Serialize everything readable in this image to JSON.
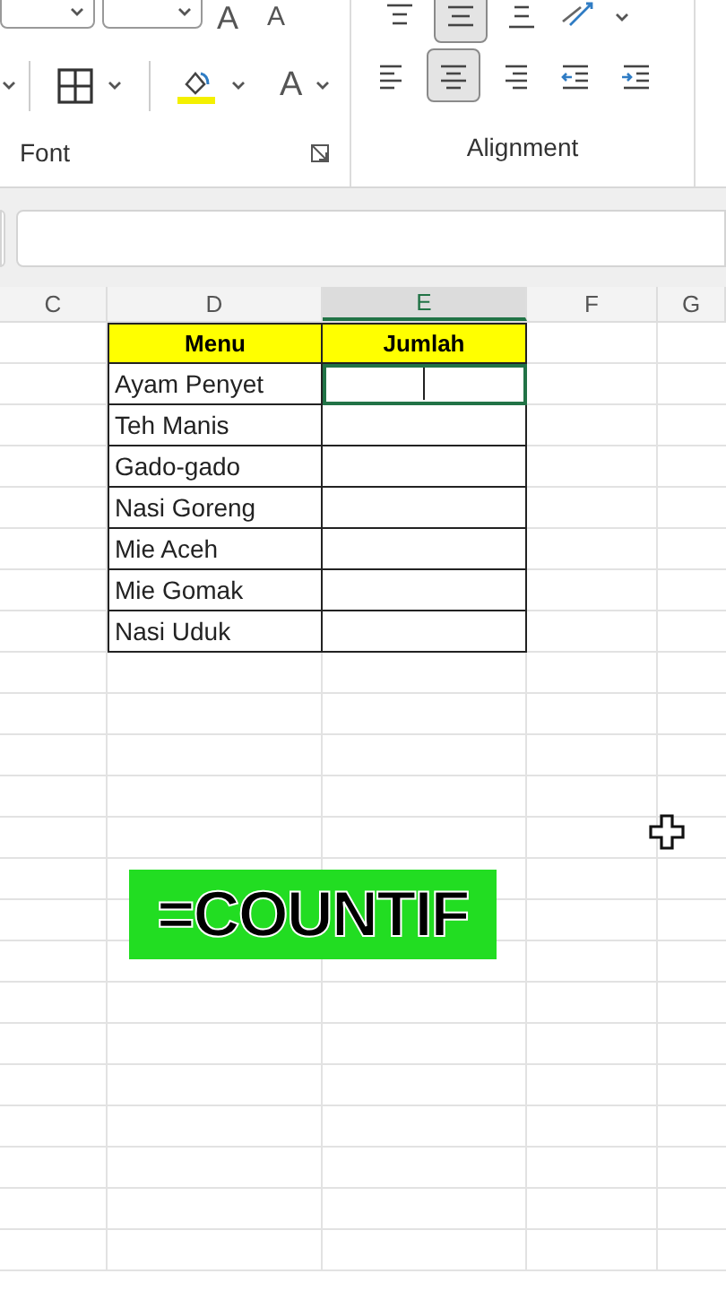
{
  "ribbon": {
    "font_group": {
      "label": "Font",
      "grow_font_glyph": "A",
      "shrink_font_glyph": "A",
      "font_color_glyph": "A"
    },
    "alignment_group": {
      "label": "Alignment",
      "vertical_align": [
        {
          "kind": "top",
          "selected": false
        },
        {
          "kind": "middle",
          "selected": true
        },
        {
          "kind": "bottom",
          "selected": false
        }
      ],
      "horizontal_align": [
        {
          "kind": "left",
          "selected": false
        },
        {
          "kind": "center",
          "selected": true
        },
        {
          "kind": "right",
          "selected": false
        },
        {
          "kind": "outdent",
          "selected": false
        },
        {
          "kind": "indent",
          "selected": false
        }
      ]
    }
  },
  "columns": [
    {
      "label": "C",
      "selected": false
    },
    {
      "label": "D",
      "selected": false
    },
    {
      "label": "E",
      "selected": true
    },
    {
      "label": "F",
      "selected": false
    },
    {
      "label": "G",
      "selected": false
    }
  ],
  "table": {
    "headers": [
      "Menu",
      "Jumlah"
    ],
    "rows": [
      {
        "menu": "Ayam Penyet",
        "selected": true
      },
      {
        "menu": "Teh Manis",
        "selected": false
      },
      {
        "menu": "Gado-gado",
        "selected": false
      },
      {
        "menu": "Nasi Goreng",
        "selected": false
      },
      {
        "menu": "Mie Aceh",
        "selected": false
      },
      {
        "menu": "Mie Gomak",
        "selected": false
      },
      {
        "menu": "Nasi Uduk",
        "selected": false
      }
    ]
  },
  "caption": "=COUNTIF"
}
